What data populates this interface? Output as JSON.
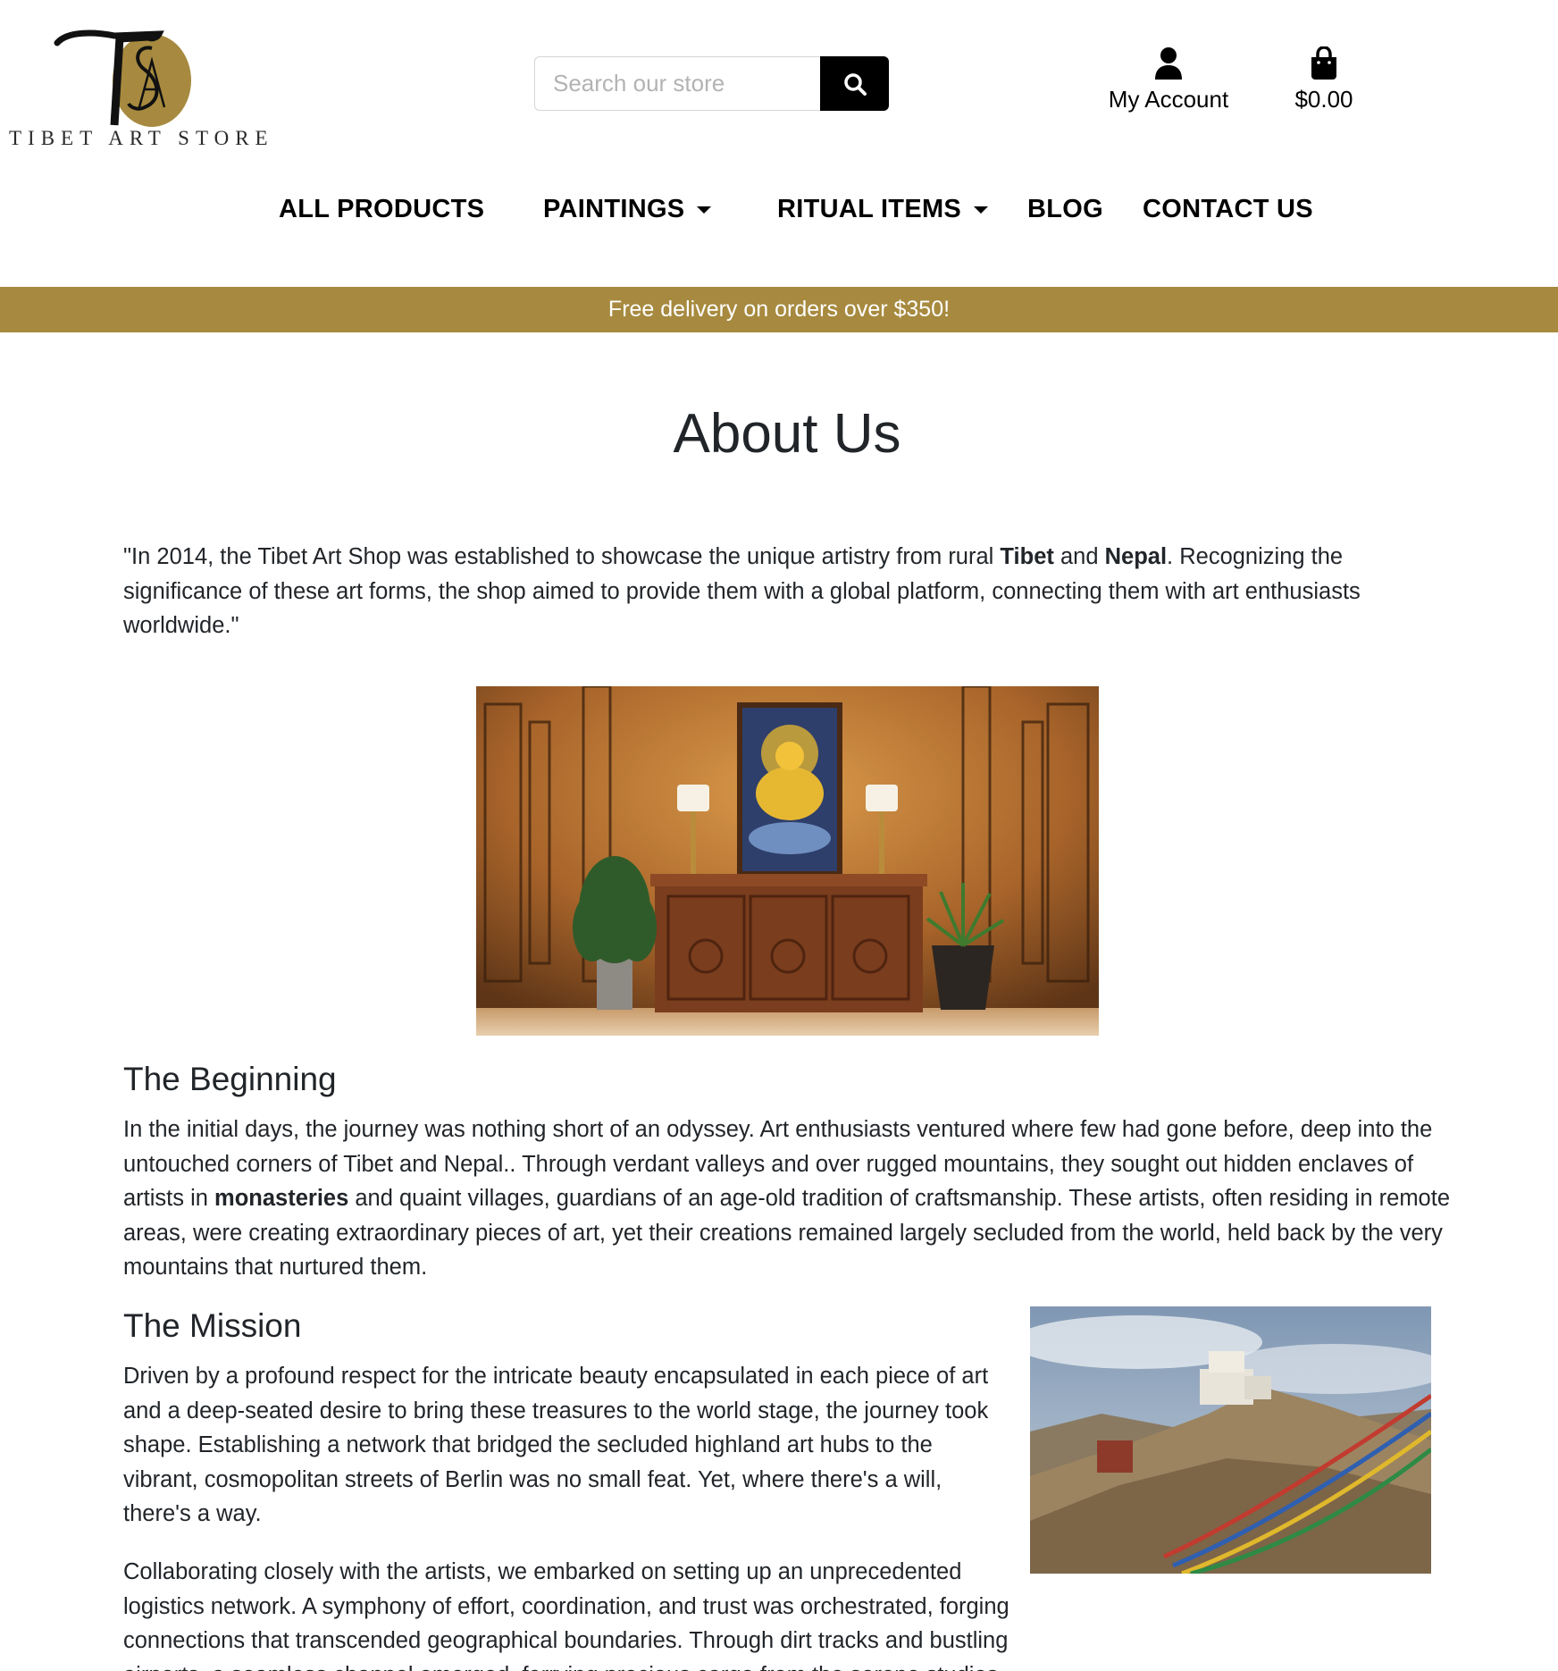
{
  "header": {
    "logo_monogram": "TAS",
    "logo_text": "TIBET ART STORE",
    "search_placeholder": "Search our store",
    "account_label": "My Account",
    "cart_total": "$0.00"
  },
  "nav": {
    "items": [
      {
        "label": "ALL PRODUCTS",
        "has_dropdown": false
      },
      {
        "label": "PAINTINGS",
        "has_dropdown": true
      },
      {
        "label": "RITUAL ITEMS",
        "has_dropdown": true
      },
      {
        "label": "BLOG",
        "has_dropdown": false
      },
      {
        "label": "CONTACT US",
        "has_dropdown": false
      }
    ]
  },
  "banner": {
    "text": "Free delivery on orders over $350!"
  },
  "page": {
    "title": "About Us",
    "intro": {
      "part1": "\"In 2014, the Tibet Art Shop was established to showcase the unique artistry from rural ",
      "bold1": "Tibet",
      "part2": " and ",
      "bold2": "Nepal",
      "part3": ". Recognizing the significance of these art forms, the shop aimed to provide them with a global platform, connecting them with art enthusiasts worldwide.\""
    },
    "beginning": {
      "heading": "The Beginning",
      "part1": "In the initial days, the journey was nothing short of an odyssey. Art enthusiasts ventured where few had gone before, deep into the untouched corners of Tibet and Nepal.. Through verdant valleys and over rugged mountains, they sought out hidden enclaves of artists in ",
      "bold": "monasteries",
      "part2": " and quaint villages, guardians of an age-old tradition of craftsmanship. These artists, often residing in remote areas, were creating extraordinary pieces of art, yet their creations remained largely secluded from the world, held back by the very mountains that nurtured them."
    },
    "mission": {
      "heading": "The Mission",
      "para1": "Driven by a profound respect for the intricate beauty encapsulated in each piece of art and a deep-seated desire to bring these treasures to the world stage, the journey took shape. Establishing a network that bridged the secluded highland art hubs to the vibrant, cosmopolitan streets of Berlin was no small feat. Yet, where there's a will, there's a way.",
      "para2": "Collaborating closely with the artists, we embarked on setting up an unprecedented logistics network. A symphony of effort, coordination, and trust was orchestrated, forging connections that transcended geographical boundaries. Through dirt tracks and bustling airports, a seamless channel emerged, ferrying precious cargo from the serene studios nestled in the Himalayas to"
    }
  },
  "colors": {
    "brand_gold": "#a78a3f",
    "text": "#212529",
    "black": "#000000"
  }
}
